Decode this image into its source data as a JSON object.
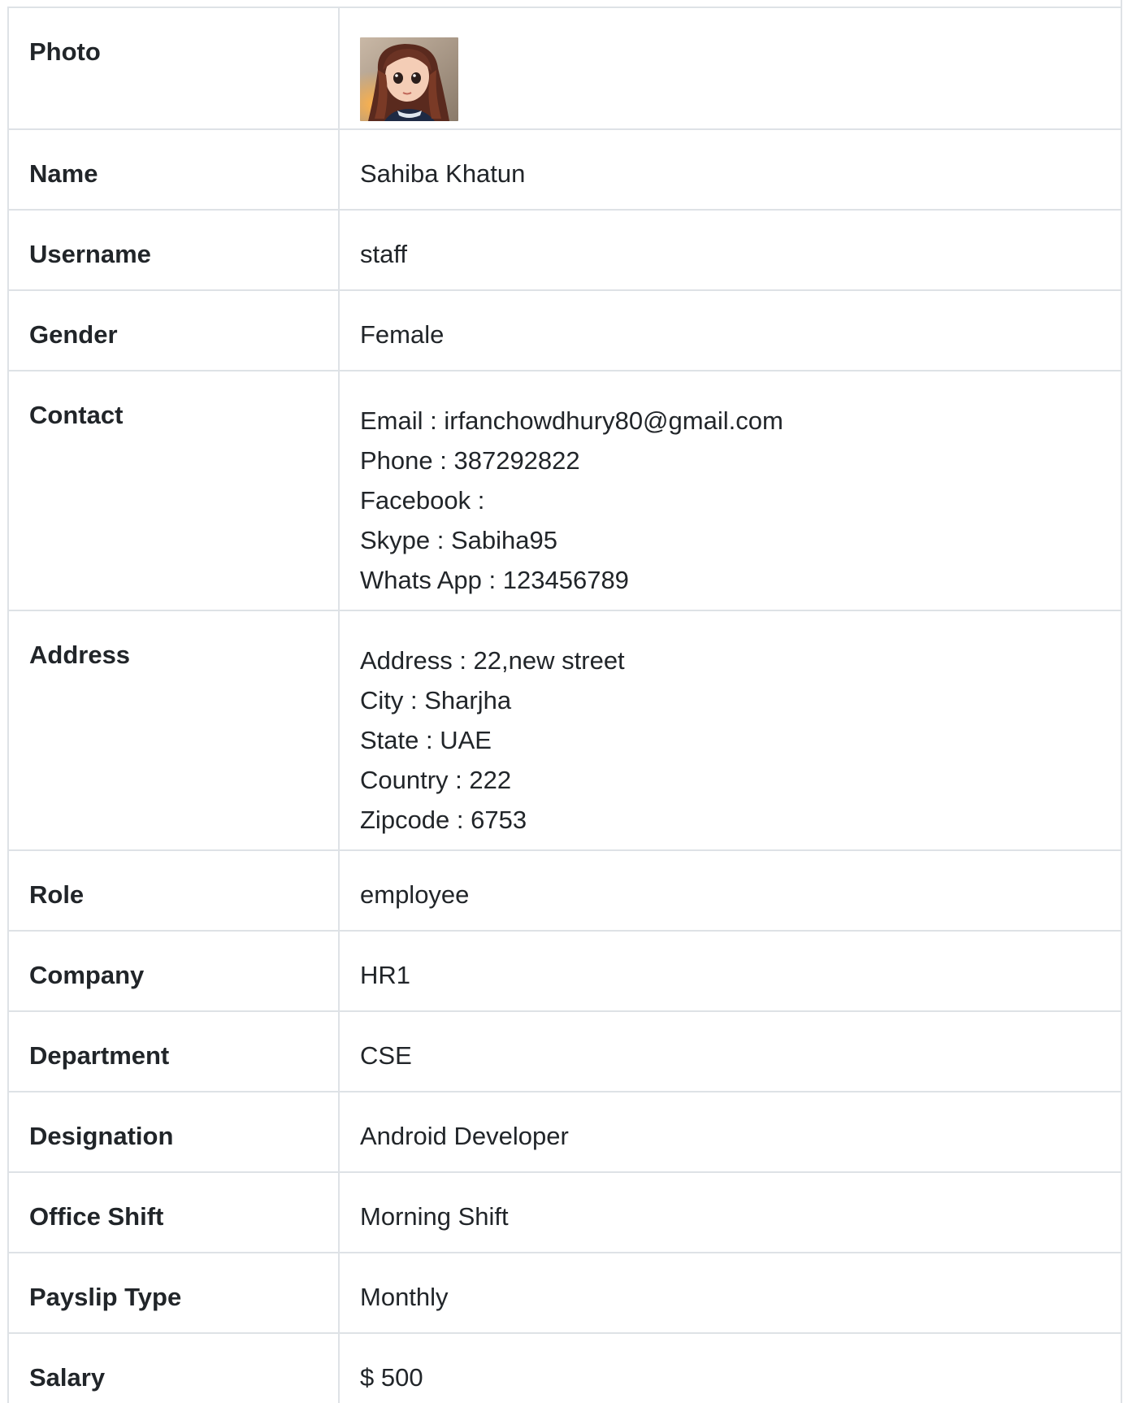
{
  "profile": {
    "rows": {
      "photo": {
        "label": "Photo"
      },
      "name": {
        "label": "Name",
        "value": "Sahiba Khatun"
      },
      "username": {
        "label": "Username",
        "value": "staff"
      },
      "gender": {
        "label": "Gender",
        "value": "Female"
      },
      "contact": {
        "label": "Contact",
        "lines": [
          "Email : irfanchowdhury80@gmail.com",
          "Phone : 387292822",
          "Facebook :",
          "Skype : Sabiha95",
          "Whats App : 123456789"
        ]
      },
      "address": {
        "label": "Address",
        "lines": [
          "Address : 22,new street",
          "City : Sharjha",
          "State : UAE",
          "Country : 222",
          "Zipcode : 6753"
        ]
      },
      "role": {
        "label": "Role",
        "value": "employee"
      },
      "company": {
        "label": "Company",
        "value": "HR1"
      },
      "department": {
        "label": "Department",
        "value": "CSE"
      },
      "designation": {
        "label": "Designation",
        "value": "Android Developer"
      },
      "office_shift": {
        "label": "Office Shift",
        "value": "Morning Shift"
      },
      "payslip_type": {
        "label": "Payslip Type",
        "value": "Monthly"
      },
      "salary": {
        "label": "Salary",
        "value": "$ 500"
      }
    }
  },
  "colors": {
    "border": "#dee2e6",
    "text": "#212529",
    "background": "#ffffff"
  }
}
